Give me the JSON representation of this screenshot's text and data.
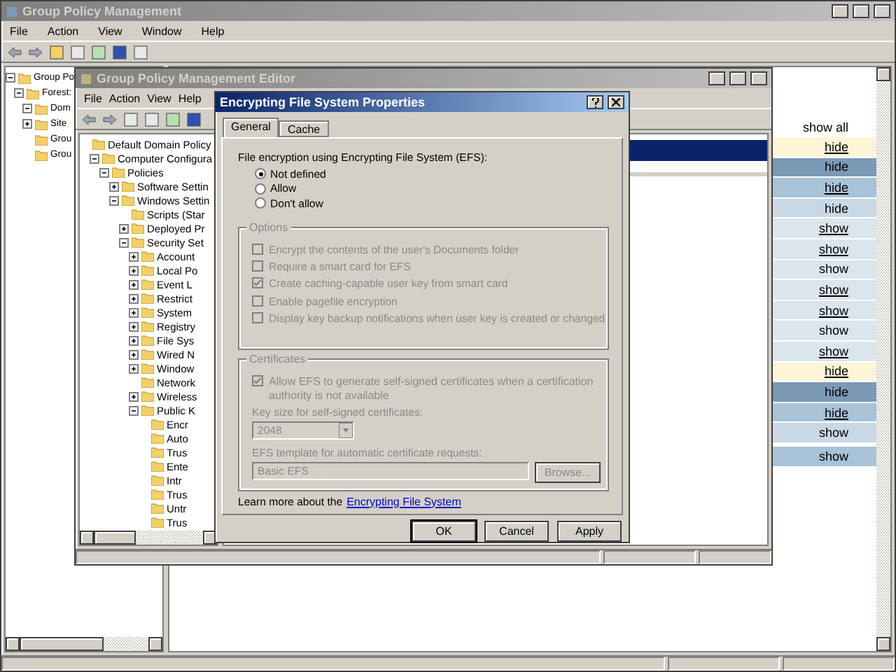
{
  "main_window": {
    "title": "Group Policy Management",
    "menu": [
      "File",
      "Action",
      "View",
      "Window",
      "Help"
    ],
    "tree": [
      {
        "label": "Group Po",
        "expanded": true,
        "children": [
          {
            "label": "Forest:",
            "expanded": true,
            "children": [
              {
                "label": "Dom",
                "expanded": true
              },
              {
                "label": "Site",
                "expanded": false
              },
              {
                "label": "Grou"
              },
              {
                "label": "Grou"
              }
            ]
          }
        ]
      }
    ],
    "show_all": "show all",
    "rows": [
      {
        "text": "hide",
        "kind": "link",
        "color": "#fdf5d6"
      },
      {
        "text": "hide",
        "kind": "text",
        "color": "#7b9ab6"
      },
      {
        "text": "hide",
        "kind": "link",
        "color": "#a8c2d8"
      },
      {
        "text": "hide",
        "kind": "text",
        "color": "#c9d8e5"
      },
      {
        "text": "show",
        "kind": "link",
        "color": "#dbe5ee"
      },
      {
        "text": "show",
        "kind": "link",
        "color": "#dbe5ee"
      },
      {
        "text": "show",
        "kind": "text",
        "color": "#dbe5ee"
      },
      {
        "text": "show",
        "kind": "link",
        "color": "#dbe5ee"
      },
      {
        "text": "show",
        "kind": "link",
        "color": "#dbe5ee"
      },
      {
        "text": "show",
        "kind": "text",
        "color": "#dbe5ee"
      },
      {
        "text": "show",
        "kind": "link",
        "color": "#dbe5ee"
      },
      {
        "text": "hide",
        "kind": "link",
        "color": "#fdf5d6"
      },
      {
        "text": "hide",
        "kind": "text",
        "color": "#7b9ab6"
      },
      {
        "text": "hide",
        "kind": "link",
        "color": "#a8c2d8"
      },
      {
        "text": "show",
        "kind": "text",
        "color": "#c9d8e5"
      },
      {
        "text": "show",
        "kind": "text",
        "color": "#a8c2d8"
      }
    ]
  },
  "editor": {
    "title": "Group Policy Management Editor",
    "menu": [
      "File",
      "Action",
      "View",
      "Help"
    ],
    "tree": [
      {
        "label": "Default Domain Policy",
        "children": [
          {
            "label": "Computer Configura",
            "expanded": true,
            "children": [
              {
                "label": "Policies",
                "expanded": true,
                "children": [
                  {
                    "label": "Software Settin",
                    "expanded": false
                  },
                  {
                    "label": "Windows Settin",
                    "expanded": true,
                    "children": [
                      {
                        "label": "Scripts (Star"
                      },
                      {
                        "label": "Deployed Pr",
                        "expanded": false
                      },
                      {
                        "label": "Security Set",
                        "expanded": true,
                        "children": [
                          {
                            "label": "Account",
                            "expanded": false
                          },
                          {
                            "label": "Local Po",
                            "expanded": false
                          },
                          {
                            "label": "Event L",
                            "expanded": false
                          },
                          {
                            "label": "Restrict",
                            "expanded": false
                          },
                          {
                            "label": "System",
                            "expanded": false
                          },
                          {
                            "label": "Registry",
                            "expanded": false
                          },
                          {
                            "label": "File Sys",
                            "expanded": false
                          },
                          {
                            "label": "Wired N",
                            "expanded": false
                          },
                          {
                            "label": "Window",
                            "expanded": false
                          },
                          {
                            "label": "Network"
                          },
                          {
                            "label": "Wireless",
                            "expanded": false
                          },
                          {
                            "label": "Public K",
                            "expanded": true,
                            "children": [
                              {
                                "label": "Encr"
                              },
                              {
                                "label": "Auto"
                              },
                              {
                                "label": "Trus"
                              },
                              {
                                "label": "Ente"
                              },
                              {
                                "label": "Intr"
                              },
                              {
                                "label": "Trus"
                              },
                              {
                                "label": "Untr"
                              },
                              {
                                "label": "Trus"
                              }
                            ]
                          }
                        ]
                      }
                    ]
                  }
                ]
              }
            ]
          }
        ]
      }
    ]
  },
  "dialog": {
    "title": "Encrypting File System Properties",
    "tabs": [
      {
        "label": "General",
        "selected": true
      },
      {
        "label": "Cache",
        "selected": false
      }
    ],
    "radio_label": "File encryption using Encrypting File System (EFS):",
    "radios": [
      {
        "label": "Not defined",
        "selected": true
      },
      {
        "label": "Allow",
        "selected": false
      },
      {
        "label": "Don't allow",
        "selected": false
      }
    ],
    "options": {
      "title": "Options",
      "items": [
        {
          "label": "Encrypt the contents of the user's Documents folder",
          "checked": false,
          "disabled": true
        },
        {
          "label": "Require a smart card for EFS",
          "checked": false,
          "disabled": true
        },
        {
          "label": "Create caching-capable user key from smart card",
          "checked": true,
          "disabled": true
        },
        {
          "label": "Enable pagefile encryption",
          "checked": false,
          "disabled": true
        },
        {
          "label": "Display key backup notifications when user key is created or changed",
          "checked": false,
          "disabled": true
        }
      ]
    },
    "certificates": {
      "title": "Certificates",
      "allow": {
        "label": "Allow EFS to generate self-signed certificates when a certification authority is not available",
        "checked": true,
        "disabled": true
      },
      "key_size_label": "Key size for self-signed certificates:",
      "key_size": "2048",
      "template_label": "EFS template for automatic certificate requests:",
      "template": "Basic EFS",
      "browse": "Browse..."
    },
    "learn_more": "Learn more about the",
    "link": "Encrypting File System",
    "buttons": [
      "OK",
      "Cancel",
      "Apply"
    ]
  }
}
